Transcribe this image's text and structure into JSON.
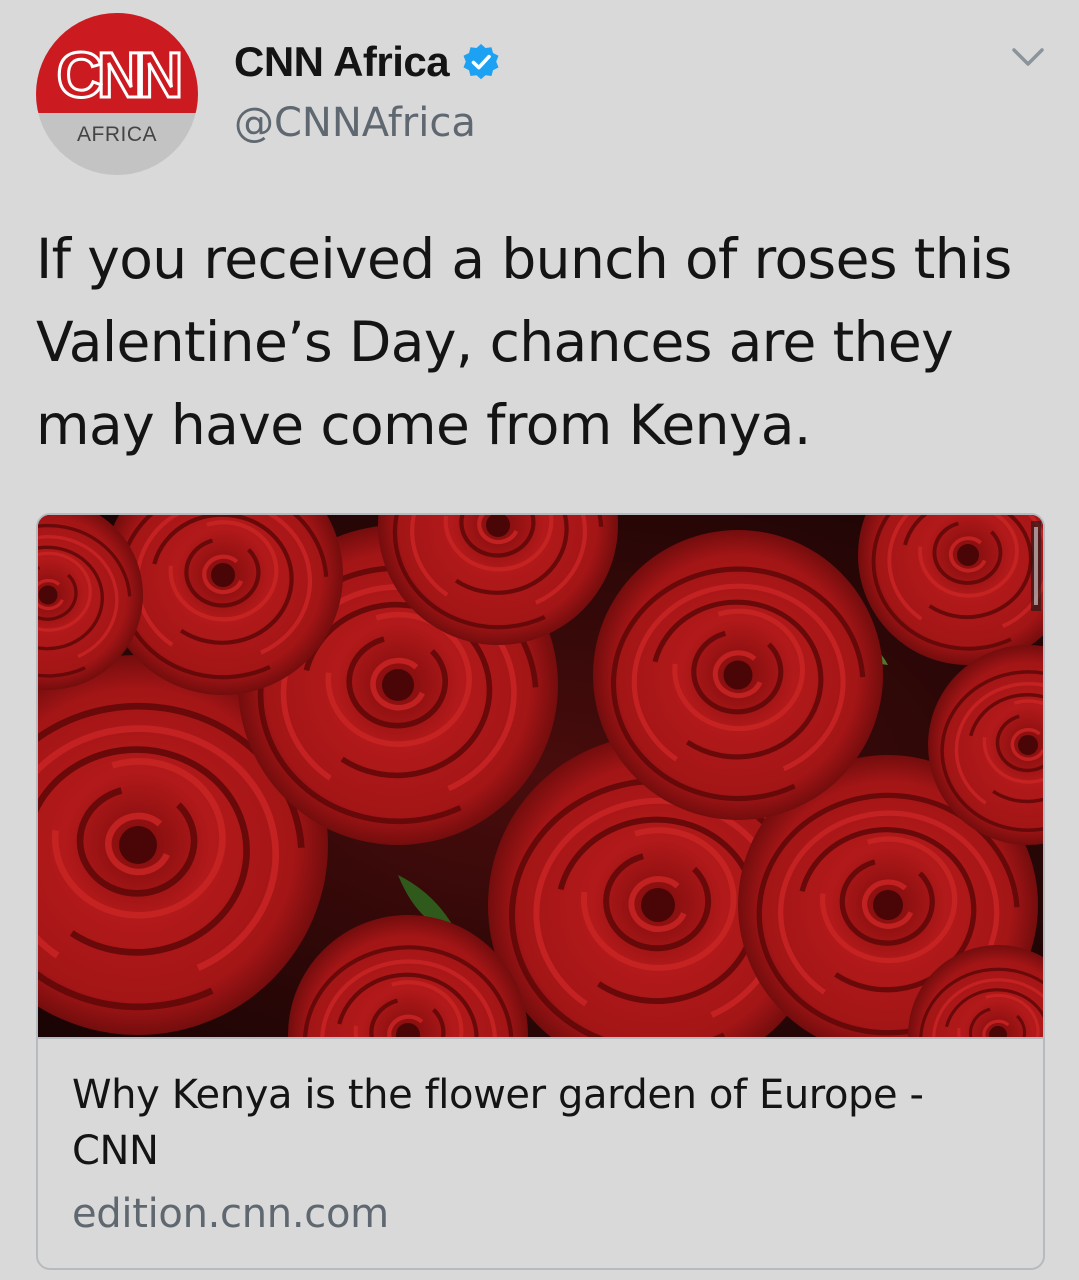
{
  "account": {
    "avatar_logo": "CNN",
    "avatar_sub": "AFRICA",
    "name": "CNN Africa",
    "handle": "@CNNAfrica",
    "verified": true
  },
  "tweet": {
    "text": "If you received a bunch of roses this Valentine’s Day, chances are they may have come from Kenya."
  },
  "card": {
    "image_icon": "roses-photo",
    "title": "Why Kenya is the flower garden of Europe - CNN",
    "domain": "edition.cnn.com"
  },
  "icons": {
    "verified": "verified-badge-icon",
    "menu": "chevron-down-icon"
  },
  "colors": {
    "cnn_red": "#cc1a21",
    "verified_blue": "#1da1f2",
    "background": "#d9d9d9",
    "muted_text": "#5f6870"
  }
}
